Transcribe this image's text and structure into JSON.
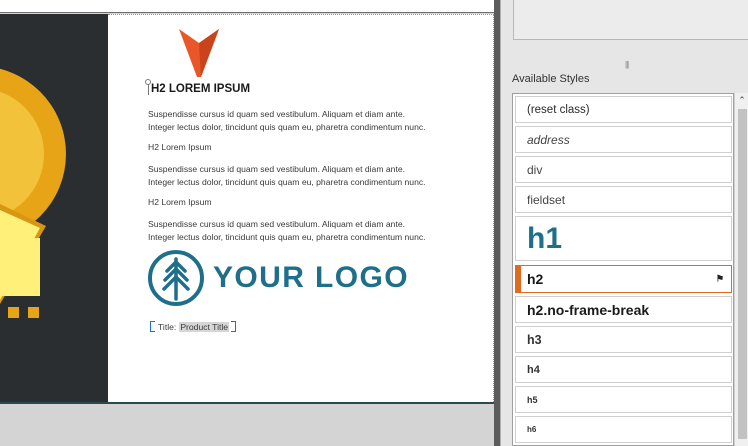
{
  "document": {
    "heading": "H2 LOREM IPSUM",
    "paragraph_line1": "Suspendisse cursus id quam sed vestibulum. Aliquam et diam ante.",
    "paragraph_line2": "Integer lectus dolor, tincidunt quis quam eu, pharetra condimentum nunc.",
    "subheading": "H2 Lorem Ipsum",
    "logo_text": "YOUR LOGO",
    "title_label": "Title:",
    "title_value": "Product Title"
  },
  "styles_panel": {
    "label": "Available Styles",
    "items": [
      {
        "label": "(reset class)"
      },
      {
        "label": "address"
      },
      {
        "label": "div"
      },
      {
        "label": "fieldset"
      },
      {
        "label": "h1"
      },
      {
        "label": "h2",
        "selected": true
      },
      {
        "label": "h2.no-frame-break"
      },
      {
        "label": "h3"
      },
      {
        "label": "h4"
      },
      {
        "label": "h5"
      },
      {
        "label": "h6"
      }
    ]
  },
  "colors": {
    "accent": "#e06a1e",
    "logo": "#1f6f8b",
    "h1": "#1f6f8b",
    "dark_panel": "#2b2e31"
  },
  "icons": {
    "brand_mark": "arrowhead-logo-icon",
    "tree_logo": "tree-logo-icon",
    "pin": "pin-icon"
  }
}
